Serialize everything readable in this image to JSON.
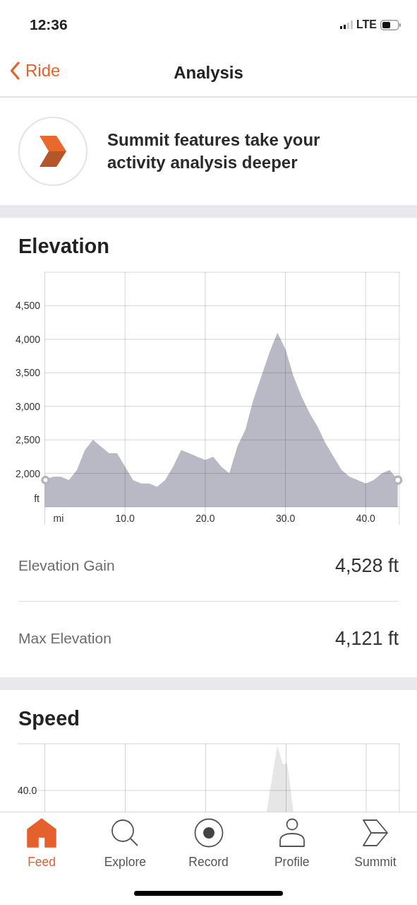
{
  "status_bar": {
    "time": "12:36",
    "network": "LTE"
  },
  "nav": {
    "back": "Ride",
    "title": "Analysis"
  },
  "promo": {
    "text": "Summit features take your activity analysis deeper"
  },
  "elevation": {
    "title": "Elevation",
    "chart_data": {
      "type": "area",
      "xlabel": "mi",
      "ylabel": "ft",
      "xlim": [
        0,
        44.2
      ],
      "ylim": [
        1500,
        5000
      ],
      "grid": true,
      "x": [
        0,
        1,
        2,
        3,
        4,
        5,
        6,
        7,
        8,
        9,
        10,
        11,
        12,
        13,
        14,
        15,
        16,
        17,
        18,
        19,
        20,
        21,
        22,
        23,
        24,
        25,
        26,
        27,
        28,
        29,
        30,
        31,
        32,
        33,
        34,
        35,
        36,
        37,
        38,
        39,
        40,
        41,
        42,
        43,
        44
      ],
      "series": [
        {
          "color": "#b9b9c5",
          "values": [
            1900,
            1950,
            1950,
            1900,
            2050,
            2350,
            2500,
            2400,
            2300,
            2300,
            2100,
            1900,
            1850,
            1850,
            1800,
            1900,
            2100,
            2350,
            2300,
            2250,
            2200,
            2250,
            2100,
            2000,
            2400,
            2650,
            3100,
            3450,
            3800,
            4100,
            3850,
            3450,
            3150,
            2900,
            2700,
            2450,
            2250,
            2050,
            1950,
            1900,
            1850,
            1900,
            2000,
            2050,
            1900
          ]
        }
      ],
      "xticks": [
        {
          "value": 10,
          "label": "10.0"
        },
        {
          "value": 20,
          "label": "20.0"
        },
        {
          "value": 30,
          "label": "30.0"
        },
        {
          "value": 40,
          "label": "40.0"
        }
      ],
      "yticks": [
        {
          "value": 2000,
          "label": "2,000"
        },
        {
          "value": 2500,
          "label": "2,500"
        },
        {
          "value": 3000,
          "label": "3,000"
        },
        {
          "value": 3500,
          "label": "3,500"
        },
        {
          "value": 4000,
          "label": "4,000"
        },
        {
          "value": 4500,
          "label": "4,500"
        }
      ]
    },
    "stats": [
      {
        "label": "Elevation Gain",
        "value": "4,528 ft"
      },
      {
        "label": "Max Elevation",
        "value": "4,121 ft"
      }
    ]
  },
  "speed": {
    "title": "Speed",
    "tick_label": "40.0"
  },
  "tabs": [
    {
      "label": "Feed",
      "kind": "home",
      "selected": true
    },
    {
      "label": "Explore",
      "kind": "search",
      "selected": false
    },
    {
      "label": "Record",
      "kind": "record",
      "selected": false
    },
    {
      "label": "Profile",
      "kind": "person",
      "selected": false
    },
    {
      "label": "Summit",
      "kind": "chevron",
      "selected": false
    }
  ]
}
